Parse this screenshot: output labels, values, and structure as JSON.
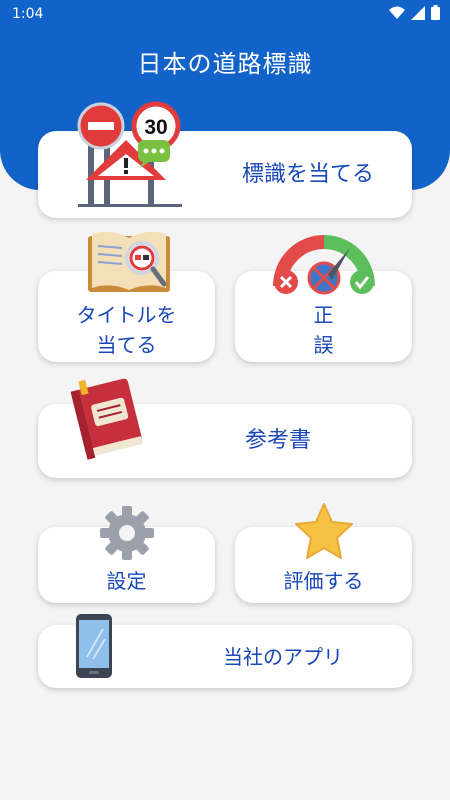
{
  "status_bar": {
    "time": "1:04",
    "icons": [
      "wifi-icon",
      "signal-icon",
      "battery-icon"
    ]
  },
  "header": {
    "title": "日本の道路標識",
    "color": "#1263c9"
  },
  "menu": {
    "guess_sign": {
      "label": "標識を当てる",
      "icon": "road-signs-icon",
      "sign_number": "30"
    },
    "guess_title": {
      "label_line1": "タイトルを",
      "label_line2": "当てる",
      "icon": "open-book-magnifier-icon"
    },
    "true_false": {
      "label_line1": "正",
      "label_line2": "誤",
      "icon": "gauge-icon"
    },
    "reference": {
      "label": "参考書",
      "icon": "red-book-icon"
    },
    "settings": {
      "label": "設定",
      "icon": "gear-icon"
    },
    "rate": {
      "label": "評価する",
      "icon": "star-icon"
    },
    "our_apps": {
      "label": "当社のアプリ",
      "icon": "smartphone-icon"
    }
  },
  "colors": {
    "accent_text": "#1a48b8",
    "background": "#f4f4f5",
    "card": "#ffffff"
  }
}
